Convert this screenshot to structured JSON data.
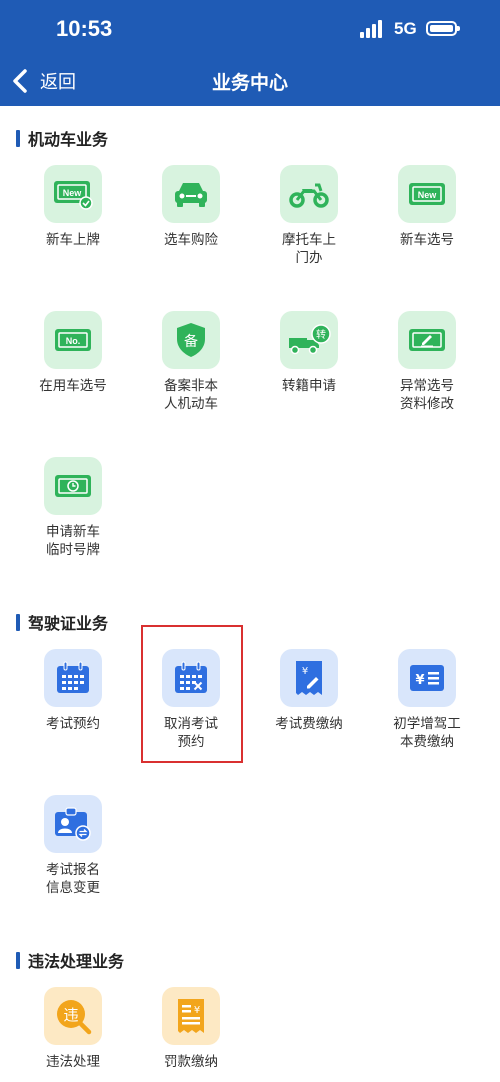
{
  "status_bar": {
    "time": "10:53",
    "network": "5G"
  },
  "header": {
    "back_label": "返回",
    "title": "业务中心"
  },
  "sections": [
    {
      "title": "机动车业务",
      "items": [
        {
          "label": "新车上牌",
          "icon": "new-plate-icon"
        },
        {
          "label": "选车购险",
          "icon": "car-icon"
        },
        {
          "label": "摩托车上\n门办",
          "icon": "motorcycle-icon"
        },
        {
          "label": "新车选号",
          "icon": "new-number-icon"
        },
        {
          "label": "在用车选号",
          "icon": "plate-number-icon"
        },
        {
          "label": "备案非本\n人机动车",
          "icon": "shield-icon"
        },
        {
          "label": "转籍申请",
          "icon": "truck-transfer-icon"
        },
        {
          "label": "异常选号\n资料修改",
          "icon": "edit-plate-icon"
        },
        {
          "label": "申请新车\n临时号牌",
          "icon": "clock-plate-icon"
        }
      ]
    },
    {
      "title": "驾驶证业务",
      "items": [
        {
          "label": "考试预约",
          "icon": "calendar-icon"
        },
        {
          "label": "取消考试\n预约",
          "icon": "calendar-cancel-icon"
        },
        {
          "label": "考试费缴纳",
          "icon": "receipt-icon"
        },
        {
          "label": "初学增驾工\n本费缴纳",
          "icon": "payment-icon"
        },
        {
          "label": "考试报名\n信息变更",
          "icon": "id-card-swap-icon"
        }
      ]
    },
    {
      "title": "违法处理业务",
      "items": [
        {
          "label": "违法处理",
          "icon": "violation-icon"
        },
        {
          "label": "罚款缴纳",
          "icon": "fine-receipt-icon"
        }
      ]
    }
  ],
  "colors": {
    "header": "#1f5bb5",
    "green": "#2fb35a",
    "blue": "#2f6fe0",
    "orange": "#f2a51c",
    "highlight": "#d93030"
  }
}
